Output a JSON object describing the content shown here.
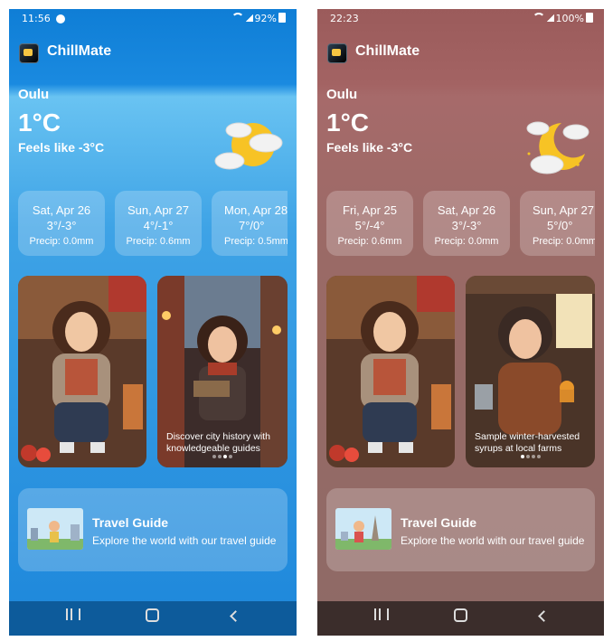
{
  "screens": [
    {
      "status_time": "11:56",
      "battery": "92%",
      "app_title": "ChillMate",
      "city": "Oulu",
      "temperature": "1°C",
      "feels_like": "Feels like -3°C",
      "weather_icon": "partly-cloudy-day-icon",
      "forecast": [
        {
          "date": "Sat, Apr 26",
          "temps": "3°/-3°",
          "precip": "Precip: 0.0mm"
        },
        {
          "date": "Sun, Apr 27",
          "temps": "4°/-1°",
          "precip": "Precip: 0.6mm"
        },
        {
          "date": "Mon, Apr 28",
          "temps": "7°/0°",
          "precip": "Precip: 0.5mm"
        }
      ],
      "carousel_caption": "Discover city history with knowledgeable guides",
      "carousel_active_index": 2,
      "carousel_count": 4,
      "guide_title": "Travel Guide",
      "guide_subtitle": "Explore the world with our travel guide"
    },
    {
      "status_time": "22:23",
      "battery": "100%",
      "app_title": "ChillMate",
      "city": "Oulu",
      "temperature": "1°C",
      "feels_like": "Feels like -3°C",
      "weather_icon": "partly-cloudy-night-icon",
      "forecast": [
        {
          "date": "Fri, Apr 25",
          "temps": "5°/-4°",
          "precip": "Precip: 0.6mm"
        },
        {
          "date": "Sat, Apr 26",
          "temps": "3°/-3°",
          "precip": "Precip: 0.0mm"
        },
        {
          "date": "Sun, Apr 27",
          "temps": "5°/0°",
          "precip": "Precip: 0.0mm"
        }
      ],
      "carousel_caption": "Sample winter-harvested syrups at local farms",
      "carousel_active_index": 0,
      "carousel_count": 4,
      "guide_title": "Travel Guide",
      "guide_subtitle": "Explore the world with our travel guide"
    }
  ]
}
